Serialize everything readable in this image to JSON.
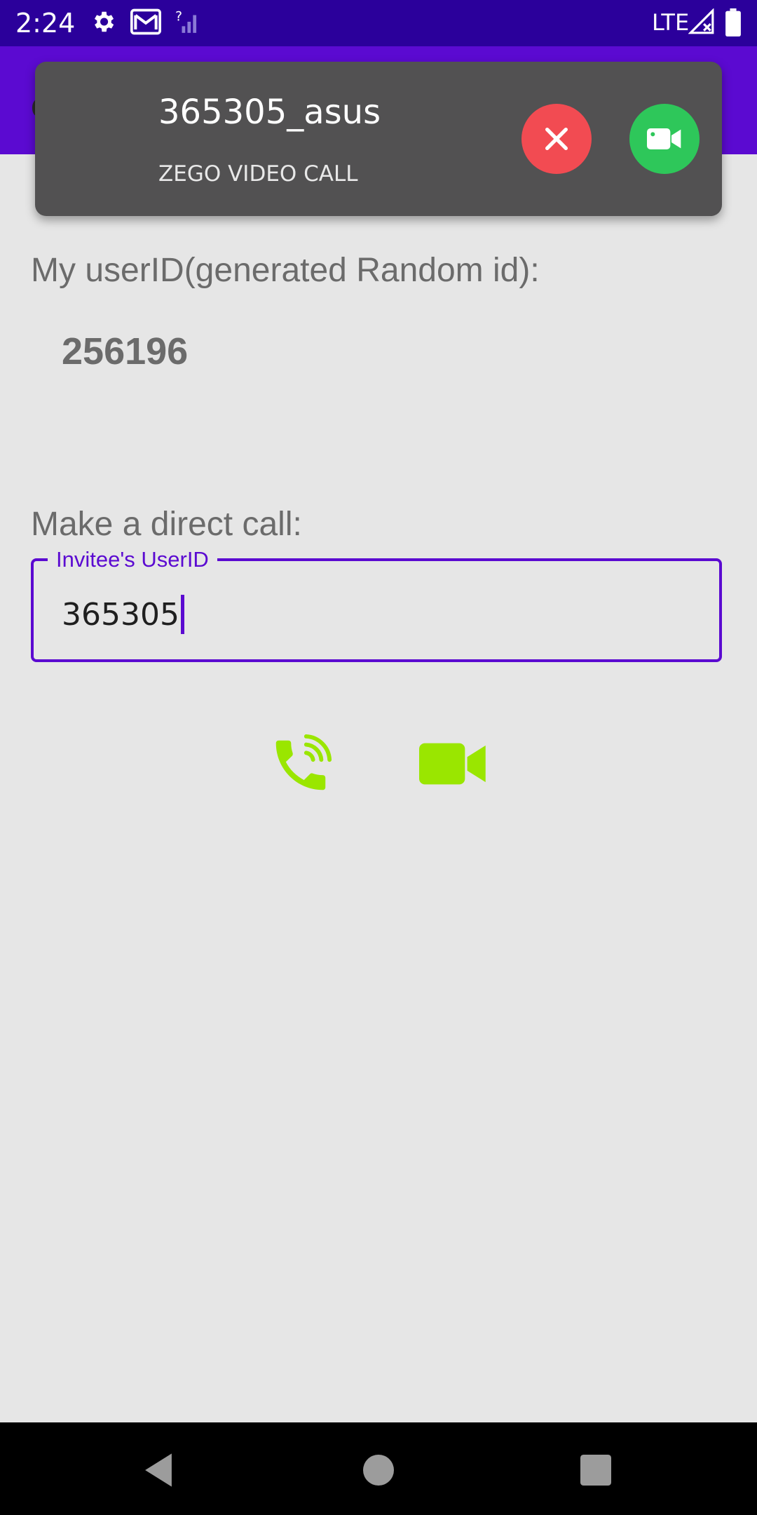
{
  "status_bar": {
    "time": "2:24",
    "network": "LTE",
    "icons": [
      "gear-icon",
      "gmail-icon",
      "no-signal-icon",
      "signal-x-icon",
      "battery-icon"
    ]
  },
  "app_bar": {
    "title": "call_with_invitation"
  },
  "notification": {
    "caller": "365305_asus",
    "subtitle": "ZEGO VIDEO CALL",
    "decline_icon": "close-icon",
    "accept_icon": "video-camera-icon"
  },
  "main": {
    "userid_label": "My userID(generated Random id):",
    "userid_value": "256196",
    "direct_call_label": "Make a direct call:",
    "invitee_field": {
      "label": "Invitee's UserID",
      "value": "365305"
    },
    "voice_call_icon": "phone-call-icon",
    "video_call_icon": "video-camera-icon"
  },
  "nav_bar": {
    "back_icon": "back-triangle-icon",
    "home_icon": "home-circle-icon",
    "recents_icon": "recents-square-icon"
  },
  "colors": {
    "status_bar": "#2b009b",
    "app_bar": "#5b0ad1",
    "notification_bg": "#525152",
    "decline": "#f24b52",
    "accept": "#2ec75a",
    "call_icon_green": "#9ae600",
    "background": "#e6e6e6"
  }
}
